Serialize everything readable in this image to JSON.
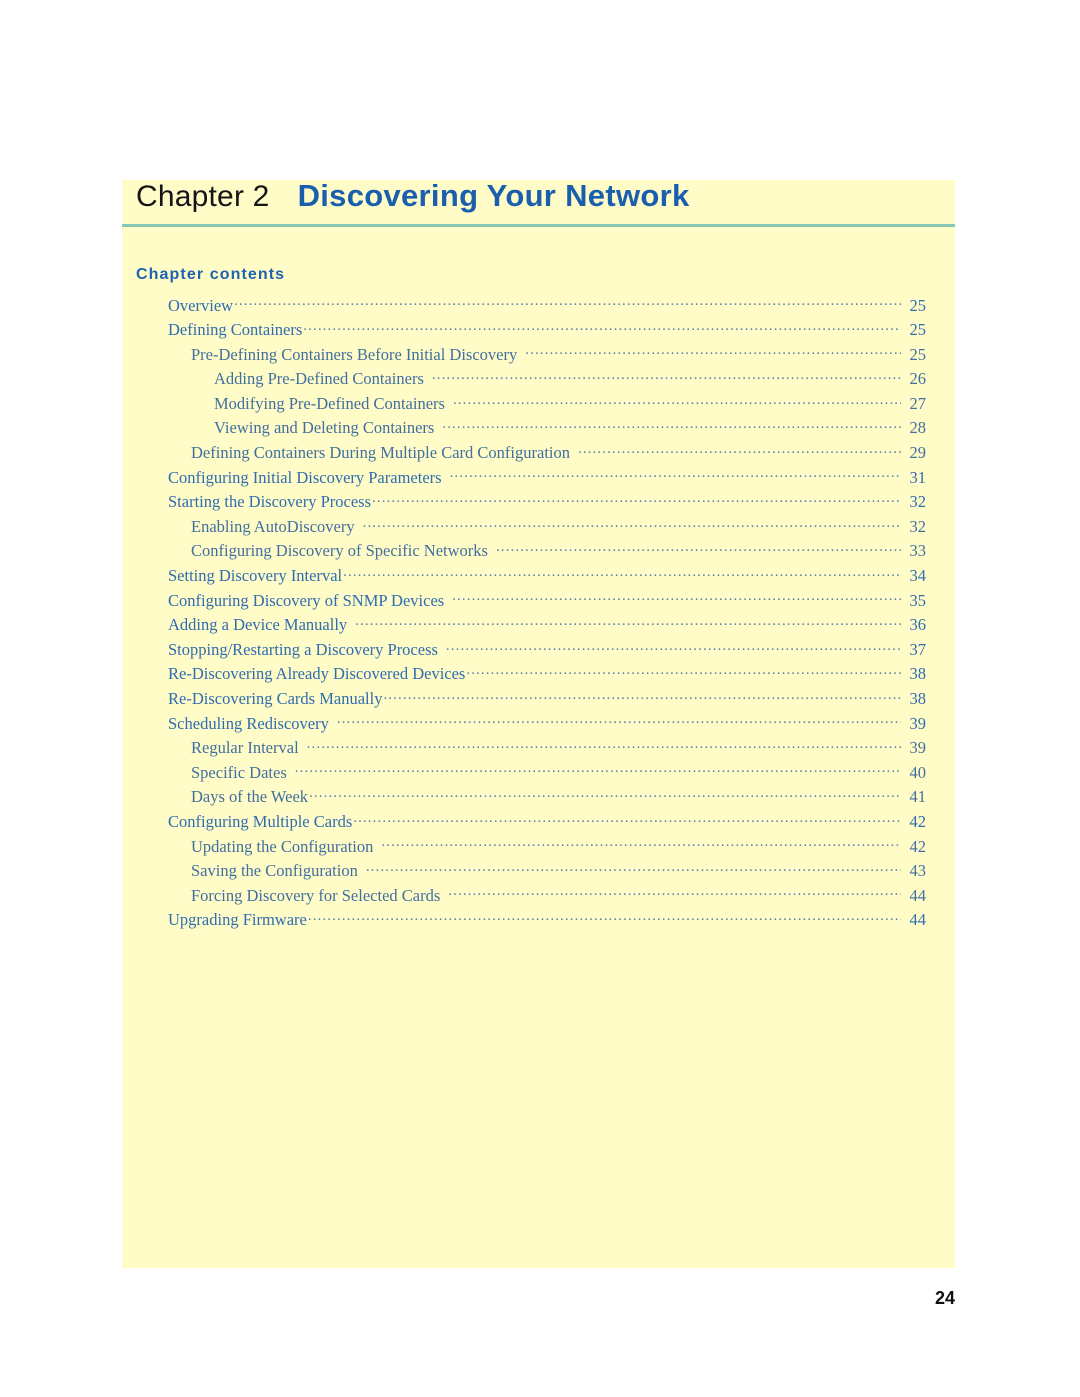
{
  "page": {
    "folio": "24",
    "background_color": "#ffffff",
    "panel_color": "#fffcc8",
    "rule_color": "#86c8b2",
    "title_color": "#1a5fae",
    "heading_color": "#1d63b0",
    "entry_color": "#3d6ea8"
  },
  "header": {
    "chapter_label": "Chapter 2",
    "chapter_title": "Discovering Your Network"
  },
  "contents": {
    "heading": "Chapter contents",
    "entries": [
      {
        "label": "Overview",
        "page": "25",
        "level": 0,
        "pregap": false
      },
      {
        "label": "Defining Containers",
        "page": "25",
        "level": 0,
        "pregap": false
      },
      {
        "label": "Pre-Defining Containers Before Initial Discovery",
        "page": "25",
        "level": 1,
        "pregap": true
      },
      {
        "label": "Adding Pre-Defined Containers",
        "page": "26",
        "level": 2,
        "pregap": true
      },
      {
        "label": "Modifying Pre-Defined Containers",
        "page": "27",
        "level": 2,
        "pregap": true
      },
      {
        "label": "Viewing and Deleting Containers",
        "page": "28",
        "level": 2,
        "pregap": true
      },
      {
        "label": "Defining Containers During Multiple Card Configuration",
        "page": "29",
        "level": 1,
        "pregap": true
      },
      {
        "label": "Configuring Initial Discovery Parameters",
        "page": "31",
        "level": 0,
        "pregap": true
      },
      {
        "label": "Starting the Discovery Process",
        "page": "32",
        "level": 0,
        "pregap": false
      },
      {
        "label": "Enabling AutoDiscovery",
        "page": "32",
        "level": 1,
        "pregap": true
      },
      {
        "label": "Configuring Discovery of Specific Networks",
        "page": "33",
        "level": 1,
        "pregap": true
      },
      {
        "label": "Setting Discovery Interval",
        "page": "34",
        "level": 0,
        "pregap": false
      },
      {
        "label": "Configuring Discovery of SNMP Devices",
        "page": "35",
        "level": 0,
        "pregap": true
      },
      {
        "label": "Adding a Device Manually",
        "page": "36",
        "level": 0,
        "pregap": true
      },
      {
        "label": "Stopping/Restarting a Discovery Process",
        "page": "37",
        "level": 0,
        "pregap": true
      },
      {
        "label": "Re-Discovering Already Discovered Devices",
        "page": "38",
        "level": 0,
        "pregap": false
      },
      {
        "label": "Re-Discovering Cards Manually",
        "page": "38",
        "level": 0,
        "pregap": false
      },
      {
        "label": "Scheduling Rediscovery",
        "page": "39",
        "level": 0,
        "pregap": true
      },
      {
        "label": "Regular Interval",
        "page": "39",
        "level": 1,
        "pregap": true
      },
      {
        "label": "Specific Dates",
        "page": "40",
        "level": 1,
        "pregap": true
      },
      {
        "label": "Days of the Week",
        "page": "41",
        "level": 1,
        "pregap": false
      },
      {
        "label": "Configuring Multiple Cards",
        "page": "42",
        "level": 0,
        "pregap": false
      },
      {
        "label": "Updating the Configuration",
        "page": "42",
        "level": 1,
        "pregap": true
      },
      {
        "label": "Saving the Configuration",
        "page": "43",
        "level": 1,
        "pregap": true
      },
      {
        "label": "Forcing Discovery for Selected Cards",
        "page": "44",
        "level": 1,
        "pregap": true
      },
      {
        "label": "Upgrading Firmware",
        "page": "44",
        "level": 0,
        "pregap": false
      }
    ]
  }
}
